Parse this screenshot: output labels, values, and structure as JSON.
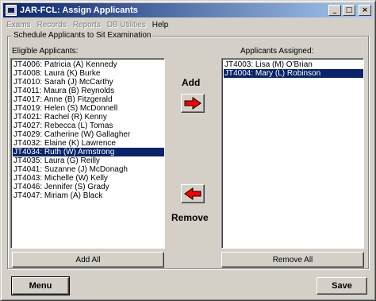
{
  "window": {
    "title": "JAR-FCL: Assign Applicants",
    "minimize": "_",
    "maximize": "□",
    "close": "×"
  },
  "menu": {
    "items": [
      {
        "label": "Exams",
        "enabled": false
      },
      {
        "label": "Records",
        "enabled": false
      },
      {
        "label": "Reports",
        "enabled": false
      },
      {
        "label": "DB Utilities",
        "enabled": false
      },
      {
        "label": "Help",
        "enabled": true
      }
    ]
  },
  "group": {
    "title": "Schedule Applicants to Sit Examination"
  },
  "eligible": {
    "label": "Eligible Applicants:",
    "items": [
      "JT4006:  Patricia (A) Kennedy",
      "JT4008:  Laura (K) Burke",
      "JT4010:  Sarah (J) McCarthy",
      "JT4011:  Maura (B) Reynolds",
      "JT4017:  Anne (B) Fitzgerald",
      "JT4019:  Helen (S) McDonnell",
      "JT4021:  Rachel (R) Kenny",
      "JT4027:  Rebecca (L) Tomas",
      "JT4029:  Catherine (W) Gallagher",
      "JT4032:  Elaine (K) Lawrence",
      "JT4034:  Ruth (W) Armstrong",
      "JT4035:  Laura (G) Reilly",
      "JT4041:  Suzanne (J) McDonagh",
      "JT4043:  Michelle (W) Kelly",
      "JT4046:  Jennifer (S) Grady",
      "JT4047:  Miriam (A) Black"
    ],
    "selected_index": 10
  },
  "assigned": {
    "label": "Applicants Assigned:",
    "items": [
      "JT4003:  Lisa (M) O'Brian",
      "JT4004:  Mary (L) Robinson"
    ],
    "selected_index": 1
  },
  "actions": {
    "add_label": "Add",
    "remove_label": "Remove",
    "add_all_label": "Add All",
    "remove_all_label": "Remove All",
    "menu_label": "Menu",
    "save_label": "Save"
  },
  "icons": {
    "add": "arrow-right-icon",
    "remove": "arrow-left-icon"
  },
  "colors": {
    "arrow_fill": "#ff0000",
    "selection": "#0a246a",
    "titlebar_start": "#0a246a",
    "titlebar_end": "#a6caf0",
    "face": "#d4d0c8"
  }
}
